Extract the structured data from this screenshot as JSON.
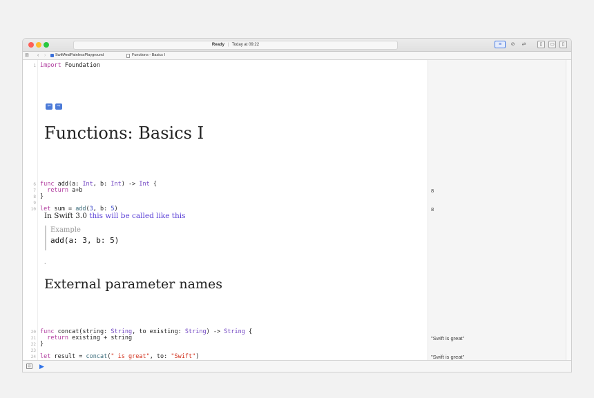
{
  "window": {
    "status_ready": "Ready",
    "status_separator": "|",
    "status_time": "Today at 09:22"
  },
  "toolbar": {
    "editor_standard_icon": "≡",
    "editor_assistant_icon": "⊘",
    "editor_version_icon": "⇄",
    "panel_left_icon": "▯",
    "panel_bottom_icon": "▭",
    "panel_right_icon": "▯"
  },
  "jumpbar": {
    "grid_icon": "⊞",
    "back_icon": "‹",
    "forward_icon": "›",
    "project": "SwiftAndPainlessPlayground",
    "chevron": "›",
    "page": "Functions - Basics I"
  },
  "editor": {
    "line_numbers": {
      "l1": "1",
      "l6": "6",
      "l7": "7",
      "l8": "8",
      "l9": "9",
      "l10": "10",
      "l20": "20",
      "l21": "21",
      "l22": "22",
      "l23": "23",
      "l24": "24",
      "l25": "25"
    },
    "import_kw": "import",
    "import_mod": " Foundation",
    "nav_prev_icon": "⇦",
    "nav_next_icon": "⇨",
    "title": "Functions: Basics I",
    "add_func": {
      "kw_func": "func",
      "sig_1": " add(a: ",
      "type_int_a": "Int",
      "sig_2": ", b: ",
      "type_int_b": "Int",
      "sig_3": ") -> ",
      "type_int_ret": "Int",
      "sig_4": " {",
      "kw_return": "  return",
      "body": " a+b",
      "close": "}"
    },
    "sum_line": {
      "kw_let": "let",
      "part_1": " sum = ",
      "fn_add": "add",
      "part_2": "(",
      "num_3": "3",
      "part_3": ", b: ",
      "num_5": "5",
      "part_4": ")"
    },
    "prose_plain": "In Swift 3.0 ",
    "prose_link": "this will be called like this",
    "example_label": "Example",
    "example_code": "add(a: 3, b: 5)",
    "dot": ".",
    "subtitle": "External parameter names",
    "concat_func": {
      "kw_func": "func",
      "sig_1": " concat(string: ",
      "type_string_a": "String",
      "sig_2": ", to existing: ",
      "type_string_b": "String",
      "sig_3": ") -> ",
      "type_string_ret": "String",
      "sig_4": " {",
      "kw_return": "  return",
      "body": " existing + string",
      "close": "}"
    },
    "result_line": {
      "kw_let": "let",
      "part_1": " result = ",
      "fn_concat": "concat",
      "part_2": "(",
      "str_1": "\" is great\"",
      "part_3": ", to: ",
      "str_2": "\"Swift\"",
      "part_4": ")"
    }
  },
  "results": {
    "add_result": "8",
    "sum_result": "8",
    "concat_result": "\"Swift is great\"",
    "result_result": "\"Swift is great\""
  },
  "debug": {
    "toggle_icon": "⊡",
    "run_icon": "▶"
  }
}
